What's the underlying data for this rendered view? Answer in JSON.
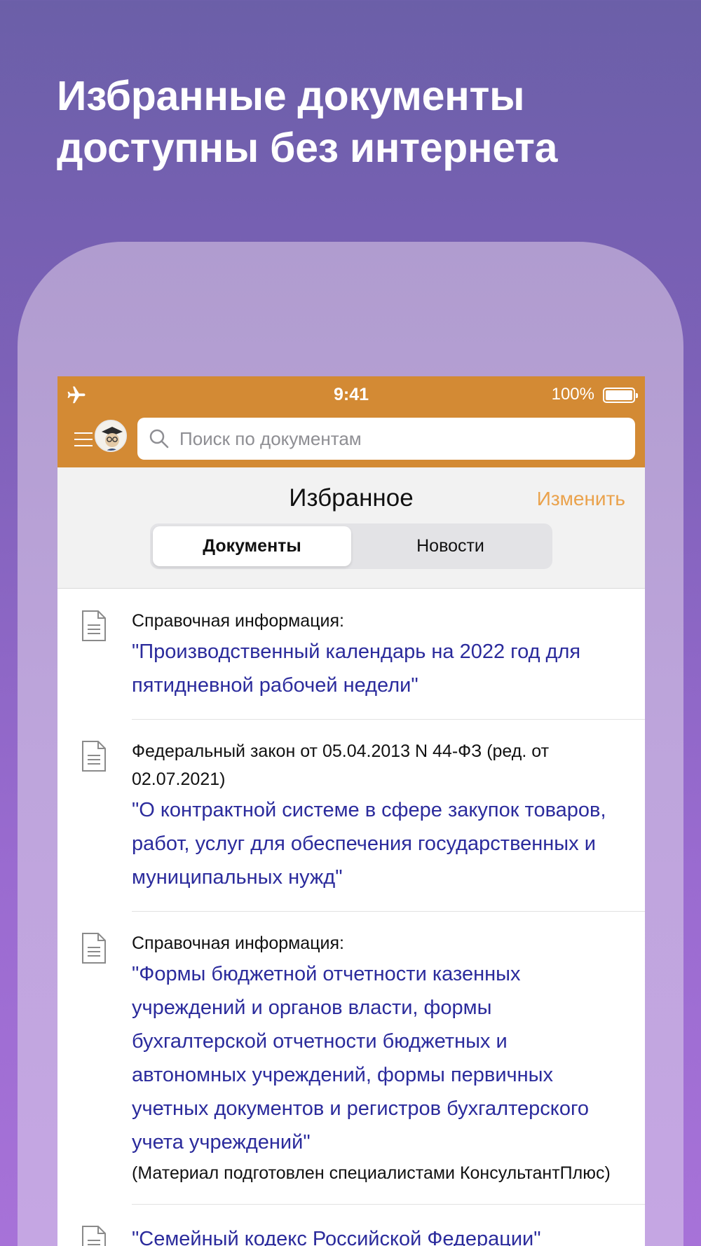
{
  "promo": {
    "title_line1": "Избранные документы",
    "title_line2": "доступны без интернета"
  },
  "status_bar": {
    "time": "9:41",
    "battery_percent": "100%",
    "icons": [
      "airplane-icon",
      "battery-icon"
    ]
  },
  "search": {
    "placeholder": "Поиск по документам"
  },
  "favorites": {
    "title": "Избранное",
    "edit_label": "Изменить",
    "tabs": [
      {
        "label": "Документы",
        "active": true
      },
      {
        "label": "Новости",
        "active": false
      }
    ]
  },
  "documents": [
    {
      "subtitle": "Справочная информация:",
      "title": "\"Производственный календарь на 2022 год для пятидневной рабочей недели\""
    },
    {
      "subtitle": "Федеральный закон от 05.04.2013 N 44-ФЗ (ред. от 02.07.2021)",
      "title": "\"О контрактной системе в сфере закупок товаров, работ, услуг для обеспечения государственных и муниципальных нужд\""
    },
    {
      "subtitle": "Справочная информация:",
      "title": "\"Формы бюджетной отчетности казенных учреждений и органов власти, формы бухгалтерской отчетности бюджетных и автономных учреждений, формы первичных учетных документов и регистров бухгалтерского учета учреждений\"",
      "note": "(Материал подготовлен специалистами КонсультантПлюс)"
    },
    {
      "title": "\"Семейный кодекс Российской Федерации\""
    }
  ],
  "colors": {
    "accent": "#d38a34",
    "edit": "#eaa24c",
    "link": "#2b2b9c"
  }
}
